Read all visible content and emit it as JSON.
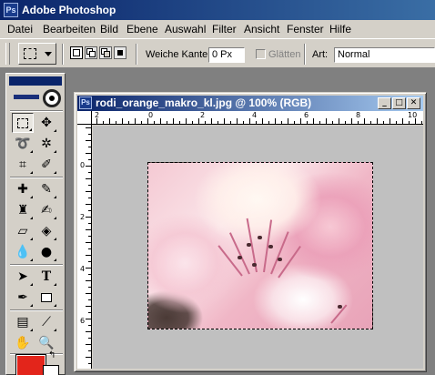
{
  "app": {
    "title": "Adobe Photoshop",
    "icon": "photoshop-app-icon"
  },
  "menu": [
    "Datei",
    "Bearbeiten",
    "Bild",
    "Ebene",
    "Auswahl",
    "Filter",
    "Ansicht",
    "Fenster",
    "Hilfe"
  ],
  "options": {
    "feather_label": "Weiche Kante:",
    "feather_value": "0 Px",
    "antialias_label": "Glätten",
    "style_label": "Art:",
    "style_value": "Normal"
  },
  "document": {
    "title": "rodi_orange_makro_kl.jpg @ 100% (RGB)",
    "hruler_labels": [
      "2",
      "0",
      "2",
      "4",
      "6",
      "8",
      "10"
    ],
    "vruler_labels": [
      "0",
      "2",
      "4",
      "6"
    ]
  },
  "colors": {
    "foreground": "#e3251b",
    "background": "#ffffff",
    "titlebar": "#0a246a"
  }
}
